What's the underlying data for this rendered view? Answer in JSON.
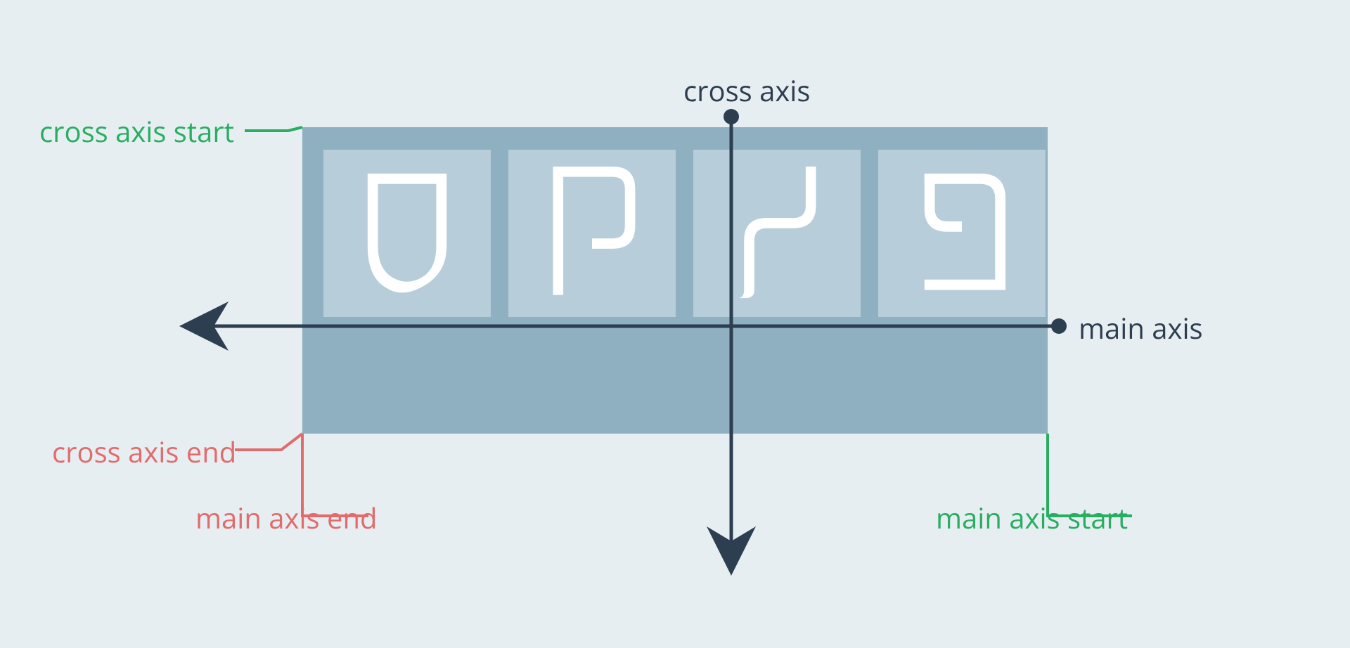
{
  "colors": {
    "background": "#e7eef2",
    "container": "#8fb0c0",
    "item": "#b7cdd9",
    "axis": "#2c3e50",
    "start": "#27ae60",
    "end": "#e26b6b"
  },
  "labels": {
    "cross_axis": "cross axis",
    "main_axis": "main axis",
    "cross_axis_start": "cross axis start",
    "cross_axis_end": "cross axis end",
    "main_axis_start": "main axis start",
    "main_axis_end": "main axis end"
  },
  "items": [
    {
      "letter": "ס"
    },
    {
      "letter": "ק"
    },
    {
      "letter": "ל"
    },
    {
      "letter": "פ"
    }
  ],
  "diagram": {
    "type": "flexbox-axes",
    "direction": "row-reverse",
    "main_axis": {
      "direction": "right-to-left",
      "start": "right",
      "end": "left"
    },
    "cross_axis": {
      "direction": "top-to-bottom",
      "start": "top",
      "end": "bottom"
    }
  }
}
